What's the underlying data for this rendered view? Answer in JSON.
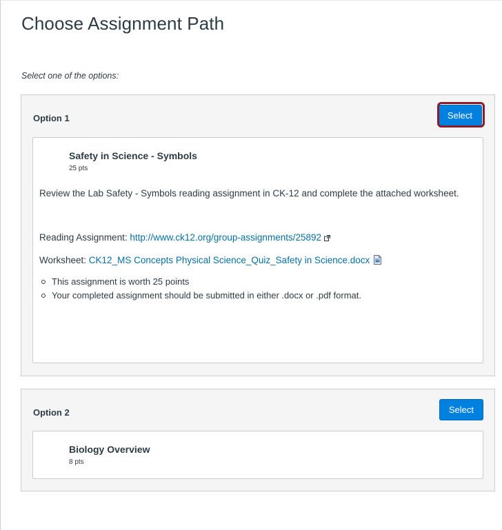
{
  "page": {
    "title": "Choose Assignment Path",
    "instructions": "Select one of the options:"
  },
  "options": [
    {
      "label": "Option 1",
      "select_label": "Select",
      "selected_highlight": true,
      "assignment": {
        "title": "Safety in Science - Symbols",
        "points": "25 pts",
        "description": "Review the Lab Safety - Symbols reading assignment in CK-12 and complete the attached worksheet.",
        "reading_label": "Reading Assignment:",
        "reading_link": "http://www.ck12.org/group-assignments/25892",
        "worksheet_label": "Worksheet:",
        "worksheet_link": "CK12_MS Concepts Physical Science_Quiz_Safety in Science.docx",
        "bullets": [
          "This assignment is worth 25 points",
          "Your completed assignment should be submitted in either .docx or .pdf format."
        ]
      }
    },
    {
      "label": "Option 2",
      "select_label": "Select",
      "selected_highlight": false,
      "assignment": {
        "title": "Biology Overview",
        "points": "8 pts"
      }
    }
  ],
  "icons": {
    "external_link": "external-link-icon",
    "document": "document-icon"
  },
  "colors": {
    "button_bg": "#0081e0",
    "link": "#0770a3",
    "highlight_ring": "#8b1c2c",
    "panel_bg": "#f5f5f5"
  }
}
